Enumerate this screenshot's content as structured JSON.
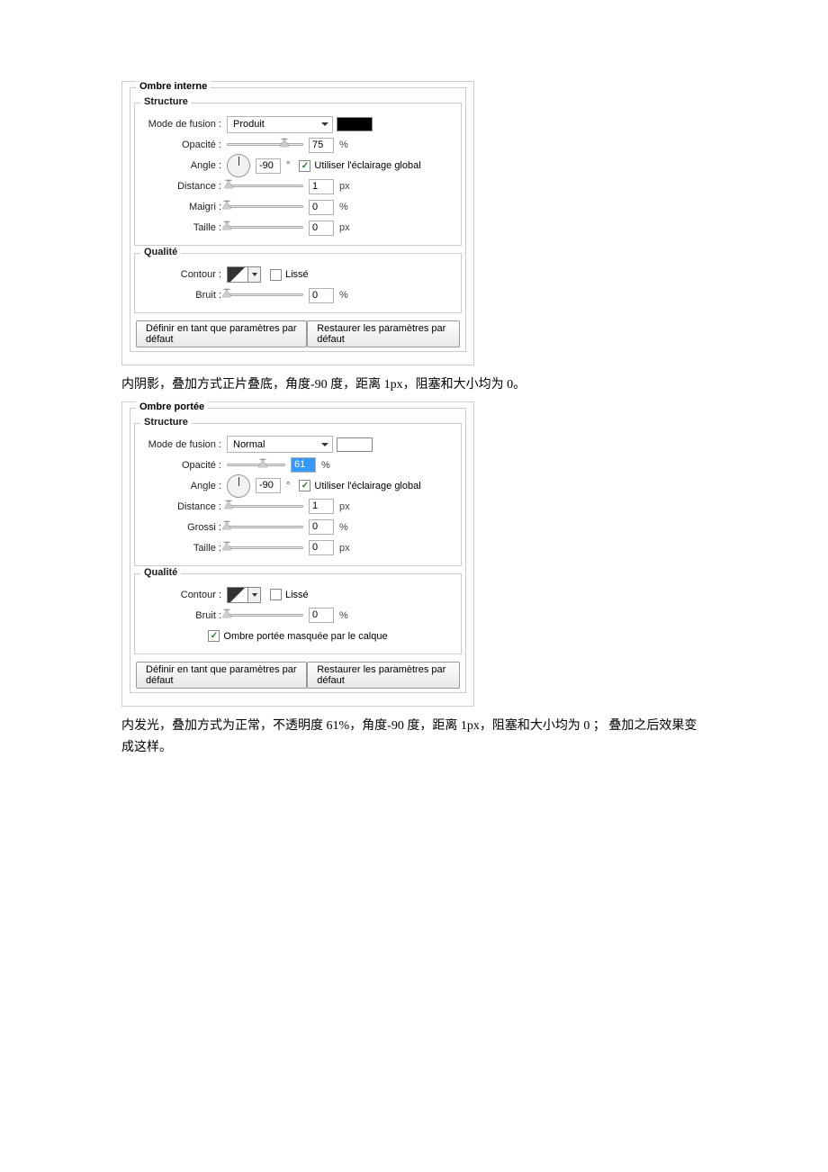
{
  "panel1": {
    "outer_title": "Ombre interne",
    "section_structure": "Structure",
    "section_quality": "Qualité",
    "blend_label": "Mode de fusion :",
    "blend_value": "Produit",
    "swatch_class": "black",
    "opacity_label": "Opacité :",
    "opacity_value": "75",
    "opacity_unit": "%",
    "opacity_pos": "75%",
    "angle_label": "Angle :",
    "angle_value": "-90",
    "angle_unit": "°",
    "global_light": "Utiliser l'éclairage global",
    "distance_label": "Distance :",
    "distance_value": "1",
    "distance_unit": "px",
    "choke_label": "Maigri :",
    "choke_value": "0",
    "choke_unit": "%",
    "size_label": "Taille :",
    "size_value": "0",
    "size_unit": "px",
    "contour_label": "Contour :",
    "antialias_label": "Lissé",
    "noise_label": "Bruit :",
    "noise_value": "0",
    "noise_unit": "%",
    "btn_default": "Définir en tant que paramètres par défaut",
    "btn_reset": "Restaurer les paramètres par défaut"
  },
  "caption1": "内阴影，叠加方式正片叠底，角度-90 度，距离 1px，阻塞和大小均为 0。",
  "panel2": {
    "outer_title": "Ombre portée",
    "section_structure": "Structure",
    "section_quality": "Qualité",
    "blend_label": "Mode de fusion :",
    "blend_value": "Normal",
    "swatch_class": "white",
    "opacity_label": "Opacité :",
    "opacity_value": "61",
    "opacity_unit": "%",
    "opacity_pos": "61%",
    "angle_label": "Angle :",
    "angle_value": "-90",
    "angle_unit": "°",
    "global_light": "Utiliser l'éclairage global",
    "distance_label": "Distance :",
    "distance_value": "1",
    "distance_unit": "px",
    "spread_label": "Grossi :",
    "spread_value": "0",
    "spread_unit": "%",
    "size_label": "Taille :",
    "size_value": "0",
    "size_unit": "px",
    "contour_label": "Contour :",
    "antialias_label": "Lissé",
    "noise_label": "Bruit :",
    "noise_value": "0",
    "noise_unit": "%",
    "knockout_label": "Ombre portée masquée par le calque",
    "btn_default": "Définir en tant que paramètres par défaut",
    "btn_reset": "Restaurer les paramètres par défaut"
  },
  "caption2": "内发光，叠加方式为正常，不透明度 61%，角度-90 度，距离 1px，阻塞和大小均为 0 ； 叠加之后效果变成这样。"
}
